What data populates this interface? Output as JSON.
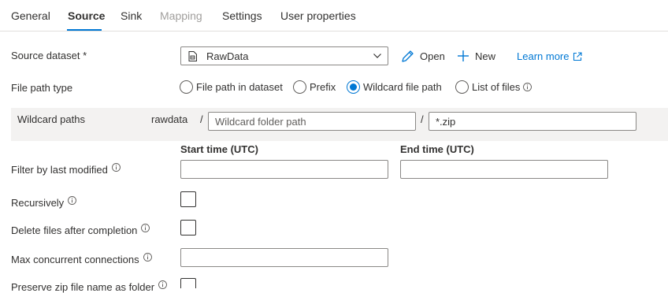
{
  "tabs": [
    {
      "label": "General"
    },
    {
      "label": "Source"
    },
    {
      "label": "Sink"
    },
    {
      "label": "Mapping"
    },
    {
      "label": "Settings"
    },
    {
      "label": "User properties"
    }
  ],
  "source_dataset": {
    "label": "Source dataset",
    "required_mark": "*",
    "selected": "RawData",
    "open_label": "Open",
    "new_label": "New",
    "learn_more_label": "Learn more"
  },
  "file_path_type": {
    "label": "File path type",
    "options": [
      {
        "label": "File path in dataset",
        "checked": false
      },
      {
        "label": "Prefix",
        "checked": false
      },
      {
        "label": "Wildcard file path",
        "checked": true
      },
      {
        "label": "List of files",
        "checked": false
      }
    ]
  },
  "wildcard_paths": {
    "label": "Wildcard paths",
    "container": "rawdata",
    "separator": "/",
    "folder_value": "",
    "folder_placeholder": "Wildcard folder path",
    "file_value": "*.zip"
  },
  "filter_last_modified": {
    "label": "Filter by last modified",
    "start_label": "Start time (UTC)",
    "end_label": "End time (UTC)",
    "start_value": "",
    "end_value": ""
  },
  "recursively": {
    "label": "Recursively",
    "checked": false
  },
  "delete_files": {
    "label": "Delete files after completion",
    "checked": false
  },
  "max_concurrent": {
    "label": "Max concurrent connections",
    "value": ""
  },
  "preserve_zip": {
    "label": "Preserve zip file name as folder",
    "checked": false
  },
  "colors": {
    "accent": "#0078d4",
    "text": "#323130",
    "disabled": "#a19f9d",
    "band": "#f3f2f1"
  }
}
